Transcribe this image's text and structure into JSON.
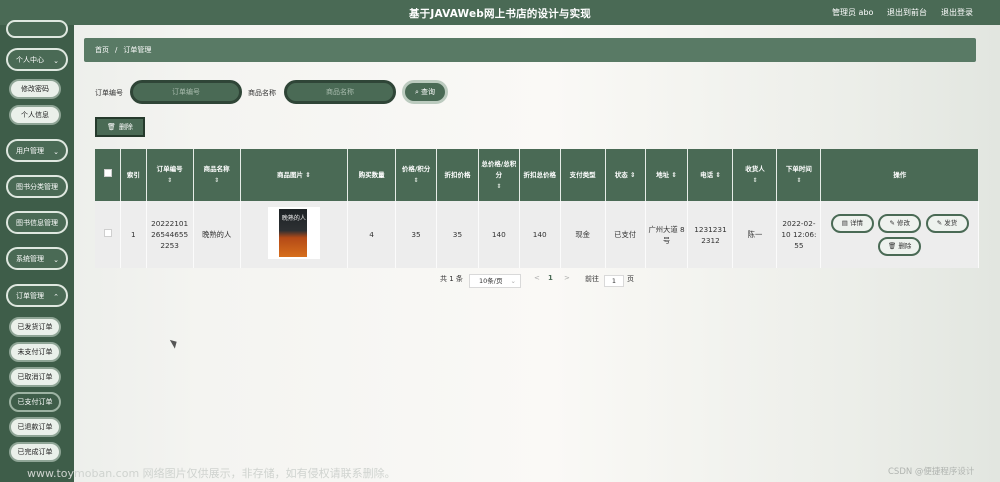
{
  "header": {
    "title": "基于JAVAWeb网上书店的设计与实现",
    "admin_label": "管理员 abo",
    "back_label": "退出到前台",
    "logout_label": "退出登录"
  },
  "sidebar": {
    "personal": "个人中心",
    "change_password": "修改密码",
    "personal_info": "个人信息",
    "user_mgmt": "用户管理",
    "category_mgmt": "图书分类管理",
    "book_mgmt": "图书信息管理",
    "system_mgmt": "系统管理",
    "order_mgmt": "订单管理",
    "shipped": "已发货订单",
    "unpaid": "未支付订单",
    "cancelled": "已取消订单",
    "paid": "已支付订单",
    "refunded": "已退款订单",
    "completed": "已完成订单"
  },
  "breadcrumb": {
    "home": "首页",
    "sep": "/",
    "current": "订单管理"
  },
  "search": {
    "order_no_label": "订单编号",
    "order_no_placeholder": "订单编号",
    "product_label": "商品名称",
    "product_placeholder": "商品名称",
    "search_button": "查询"
  },
  "toolbar": {
    "delete_label": "删除"
  },
  "table": {
    "headers": {
      "index": "索引",
      "order_no": "订单编号",
      "product": "商品名称",
      "image": "商品图片",
      "qty": "购买数量",
      "price": "价格/积分",
      "discount_price": "折扣价格",
      "total": "总价格/总积分",
      "discount_total": "折扣总价格",
      "pay_type": "支付类型",
      "status": "状态",
      "address": "地址",
      "phone": "电话",
      "receiver": "收货人",
      "order_time": "下单时间",
      "actions": "操作"
    },
    "rows": [
      {
        "index": "1",
        "order_no": "20222101 26544655 2253",
        "product": "晚熟的人",
        "book_cover_text": "晚熟的人",
        "qty": "4",
        "price": "35",
        "discount_price": "35",
        "total": "140",
        "discount_total": "140",
        "pay_type": "现金",
        "status": "已支付",
        "address": "广州大道 8号",
        "phone": "1231231 2312",
        "receiver": "陈一",
        "order_time": "2022-02- 10 12:06: 55",
        "actions": {
          "detail": "详情",
          "edit": "修改",
          "ship": "发货",
          "delete": "删除"
        }
      }
    ]
  },
  "pagination": {
    "total_text": "共 1 条",
    "page_size": "10条/页",
    "prev": "<",
    "current_page": "1",
    "next": ">",
    "goto_label": "前往",
    "goto_value": "1",
    "page_suffix": "页"
  },
  "watermark": "www.toymoban.com 网络图片仅供展示，非存储，如有侵权请联系删除。",
  "credit": "CSDN @便捷程序设计"
}
